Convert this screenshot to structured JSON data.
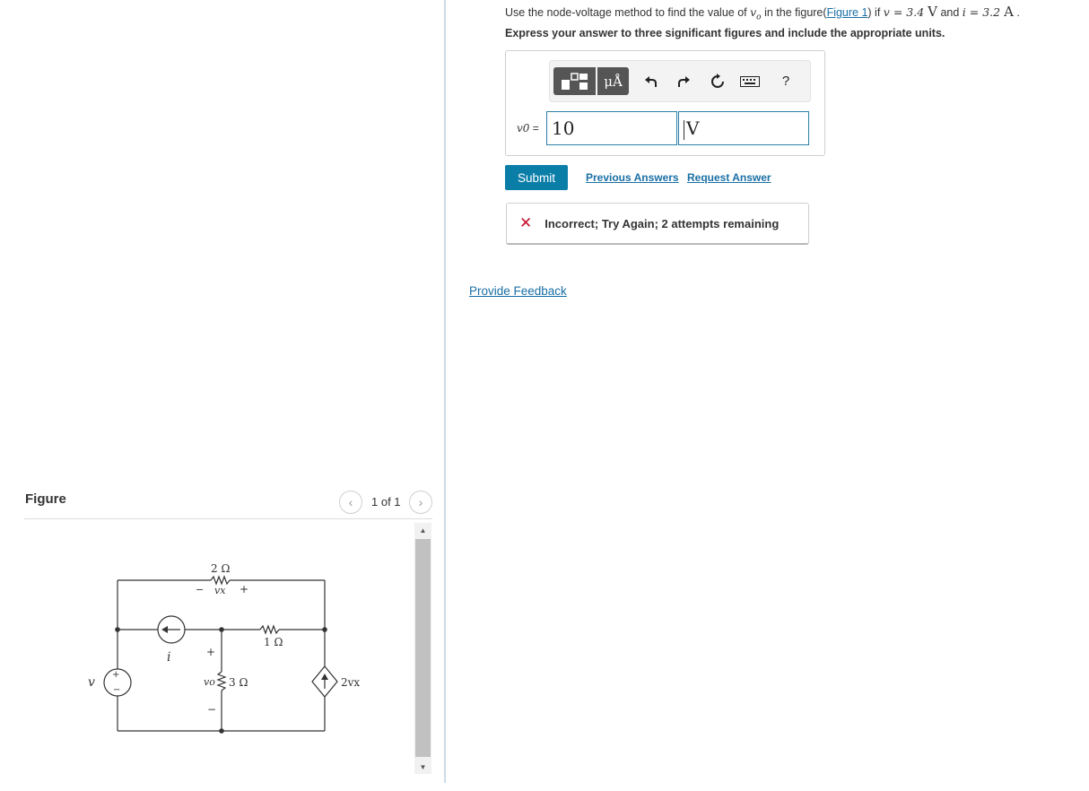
{
  "question": {
    "prefix": "Use the node-voltage method to find the value of ",
    "var_vo": "vo",
    "mid": " in the figure(",
    "figure_link": "Figure 1",
    "after_link": ") if ",
    "v_eq": "v = 3.4 ",
    "v_unit": "V",
    "and": " and ",
    "i_eq": "i = 3.2 ",
    "i_unit": "A",
    "end": " ."
  },
  "instruction": "Express your answer to three significant figures and include the appropriate units.",
  "toolbar": {
    "units_label": "μÅ",
    "help_label": "?",
    "icons": [
      "templates-icon",
      "units-icon",
      "undo-icon",
      "redo-icon",
      "reset-icon",
      "keyboard-icon",
      "help-icon"
    ]
  },
  "answer": {
    "label_var": "v0",
    "label_eq": " =",
    "value": "10",
    "unit": "V"
  },
  "actions": {
    "submit": "Submit",
    "previous_answers": "Previous Answers",
    "request_answer": "Request Answer"
  },
  "feedback": {
    "icon": "x-icon",
    "text": "Incorrect; Try Again; 2 attempts remaining"
  },
  "provide_feedback": "Provide Feedback",
  "figure": {
    "title": "Figure",
    "pager_text": "1 of 1",
    "labels": {
      "r1": "2 Ω",
      "vx_minus": "−",
      "vx": "vx",
      "vx_plus": "+",
      "r2": "1 Ω",
      "r3": "3 Ω",
      "i": "i",
      "v": "v",
      "vs_plus": "+",
      "vs_minus": "−",
      "vo_plus": "+",
      "vo": "vo",
      "vo_minus": "−",
      "dep": "2vx"
    }
  },
  "colors": {
    "link": "#1a6fa5",
    "submit": "#0b7ea8",
    "error": "#c8102e",
    "toolbar_button": "#555555"
  }
}
